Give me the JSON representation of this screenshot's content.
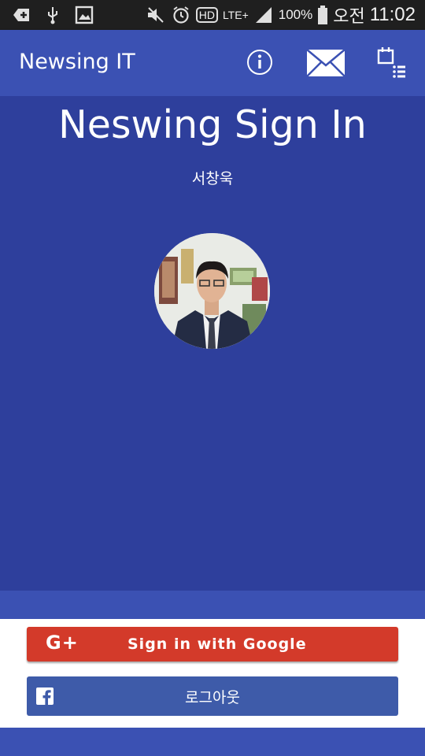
{
  "status_bar": {
    "battery": "100%",
    "ampm": "오전",
    "time": "11:02",
    "hd_label": "HD",
    "lte_label": "LTE+"
  },
  "app_bar": {
    "title": "Newsing IT",
    "icons": [
      "info-icon",
      "mail-icon",
      "calendar-list-icon"
    ]
  },
  "main": {
    "title": "Neswing Sign In",
    "user_name": "서창욱",
    "avatar": "profile-photo"
  },
  "login": {
    "google_logo": "G+",
    "google_label": "Sign in with Google",
    "facebook_icon": "facebook-icon",
    "facebook_label": "로그아웃"
  },
  "colors": {
    "app_bar": "#3b51b3",
    "background": "#2e3f9c",
    "google_red": "#d33a2a",
    "facebook_blue": "#3e5ba9",
    "status_bar": "#1f1f1f"
  }
}
